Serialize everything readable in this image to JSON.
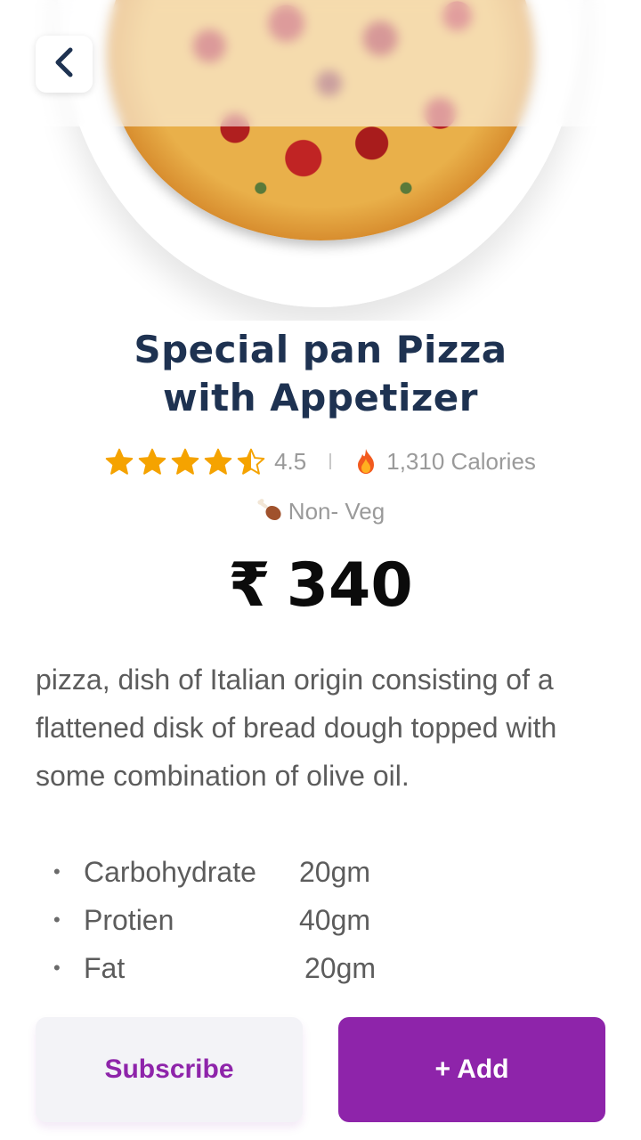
{
  "product": {
    "title_line1": "Special pan Pizza",
    "title_line2": "with Appetizer",
    "rating": "4.5",
    "rating_value": 4.5,
    "calories": "1,310 Calories",
    "diet": "Non- Veg",
    "currency": "₹",
    "price": "340",
    "description": "pizza, dish of Italian origin consisting of a flattened disk of bread dough topped with some combination of olive oil."
  },
  "nutrients": [
    {
      "bullet": "•",
      "name": "Carbohydrate",
      "value": "20gm"
    },
    {
      "bullet": "•",
      "name": "Protien",
      "value": "40gm"
    },
    {
      "bullet": "•",
      "name": "Fat",
      "value": "20gm"
    }
  ],
  "actions": {
    "subscribe_label": "Subscribe",
    "add_label": "+ Add"
  },
  "icons": {
    "back": "chevron-left-icon",
    "star": "star-icon",
    "fire": "fire-icon",
    "diet": "chicken-leg-icon"
  },
  "colors": {
    "primary": "#8e24aa",
    "title": "#1e3251",
    "star": "#f5a300",
    "text_muted": "#9a9a9a",
    "body_text": "#5c5c5c"
  }
}
